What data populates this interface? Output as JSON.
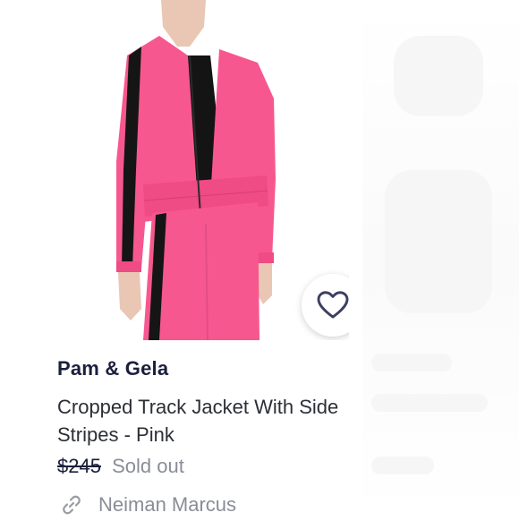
{
  "product": {
    "brand": "Pam & Gela",
    "title": "Cropped Track Jacket With Side Stripes - Pink",
    "price_original": "$245",
    "status": "Sold out",
    "retailer": "Neiman Marcus"
  },
  "icons": {
    "favorite": "heart-outline-icon",
    "retailer_link": "link-icon"
  },
  "colors": {
    "jacket_pink": "#f7578f",
    "stripe": "#151515",
    "heart_stroke": "#3c4060",
    "brand_text": "#1b1f3b",
    "muted_text": "#8a8d96"
  }
}
